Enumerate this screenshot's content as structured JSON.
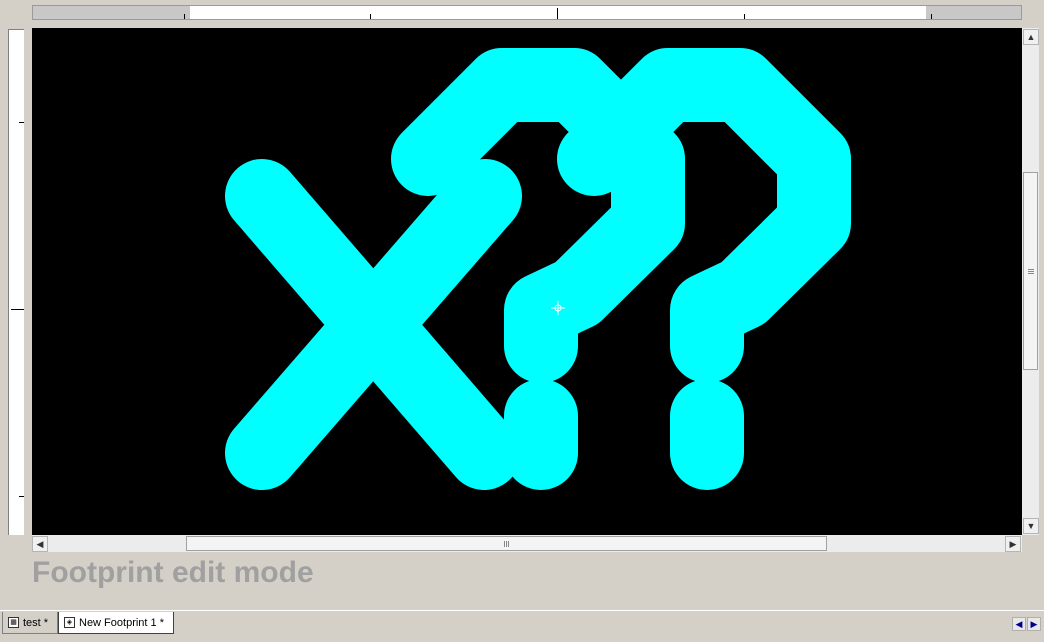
{
  "canvas": {
    "background": "#000000",
    "trace_color": "#00ffff",
    "footprint_glyphs": "X??"
  },
  "status": {
    "mode_text": "Footprint edit mode"
  },
  "tabs": [
    {
      "label": "test *",
      "icon": "board-icon",
      "active": false
    },
    {
      "label": "New Footprint 1 *",
      "icon": "footprint-icon",
      "active": true
    }
  ],
  "scrollbars": {
    "up": "▲",
    "down": "▼",
    "left": "◀",
    "right": "▶"
  },
  "tab_nav": {
    "prev": "◀",
    "next": "▶"
  }
}
